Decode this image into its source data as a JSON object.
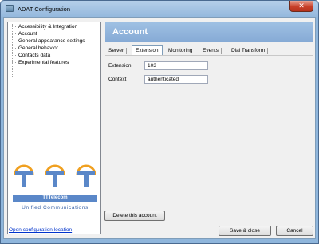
{
  "window": {
    "title": "ADAT Configuration",
    "close_glyph": "✕"
  },
  "tree": {
    "items": [
      {
        "label": "Accessibility & Integration"
      },
      {
        "label": "Account"
      },
      {
        "label": "General appearance settings"
      },
      {
        "label": "General behavior"
      },
      {
        "label": "Contacts data"
      },
      {
        "label": "Experimental features"
      }
    ]
  },
  "logo": {
    "brand": "TTTelecom",
    "tagline": "Unified Communications"
  },
  "header": {
    "title": "Account"
  },
  "tabs": [
    {
      "label": "Server"
    },
    {
      "label": "Extension"
    },
    {
      "label": "Monitoring"
    },
    {
      "label": "Events"
    },
    {
      "label": "Dial Transform"
    }
  ],
  "active_tab": "Extension",
  "fields": {
    "extension": {
      "label": "Extension",
      "value": "103"
    },
    "context": {
      "label": "Context",
      "value": "authenticated"
    }
  },
  "buttons": {
    "delete_account": "Delete this account",
    "save_close": "Save & close",
    "cancel": "Cancel"
  },
  "footer": {
    "open_config_link": "Open configuration location"
  },
  "colors": {
    "header_bg": "#8fb3dc",
    "logo_blue": "#5a87c8",
    "logo_orange": "#f0a020"
  }
}
